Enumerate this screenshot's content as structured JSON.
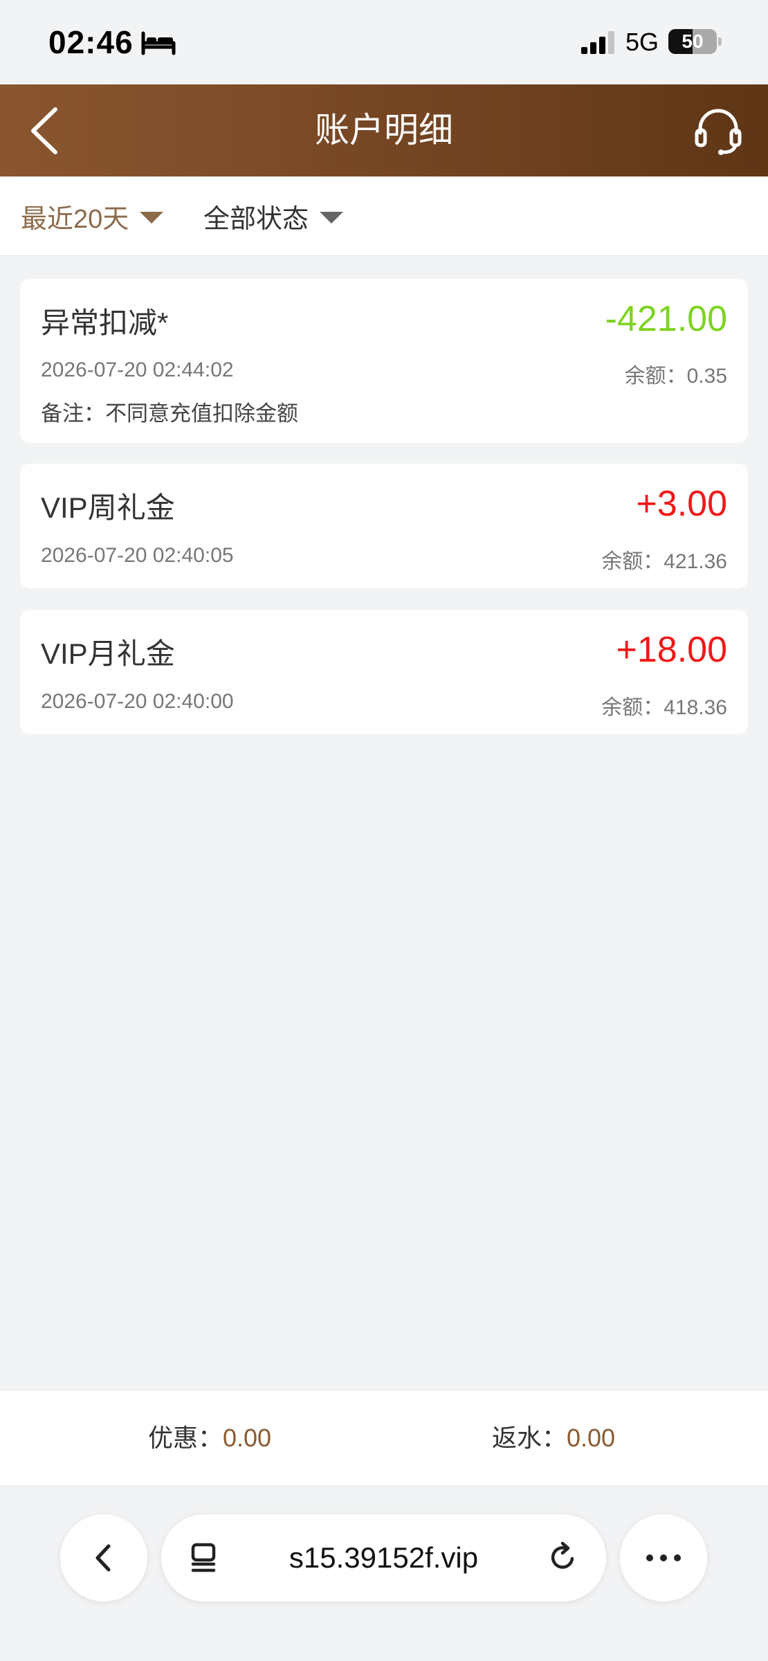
{
  "status_bar": {
    "time": "02:46",
    "network": "5G",
    "battery": "50",
    "battery_level": 0.5
  },
  "header": {
    "title": "账户明细",
    "back_icon": "chevron-left-icon",
    "service_icon": "headset-icon"
  },
  "filters": {
    "days": "最近20天",
    "status": "全部状态"
  },
  "records": [
    {
      "title": "异常扣减*",
      "amount": "-421.00",
      "amount_color": "#7ed321",
      "time": "2026-07-20 02:44:02",
      "balance": "余额：0.35",
      "note": "备注：不同意充值扣除金额"
    },
    {
      "title": "VIP周礼金",
      "amount": "+3.00",
      "amount_color": "#f01818",
      "time": "2026-07-20 02:40:05",
      "balance": "余额：421.36"
    },
    {
      "title": "VIP月礼金",
      "amount": "+18.00",
      "amount_color": "#f01818",
      "time": "2026-07-20 02:40:00",
      "balance": "余额：418.36"
    }
  ],
  "summary": {
    "discount_label": "优惠：",
    "discount_value": "0.00",
    "rebate_label": "返水：",
    "rebate_value": "0.00"
  },
  "browser": {
    "url": "s15.39152f.vip"
  }
}
